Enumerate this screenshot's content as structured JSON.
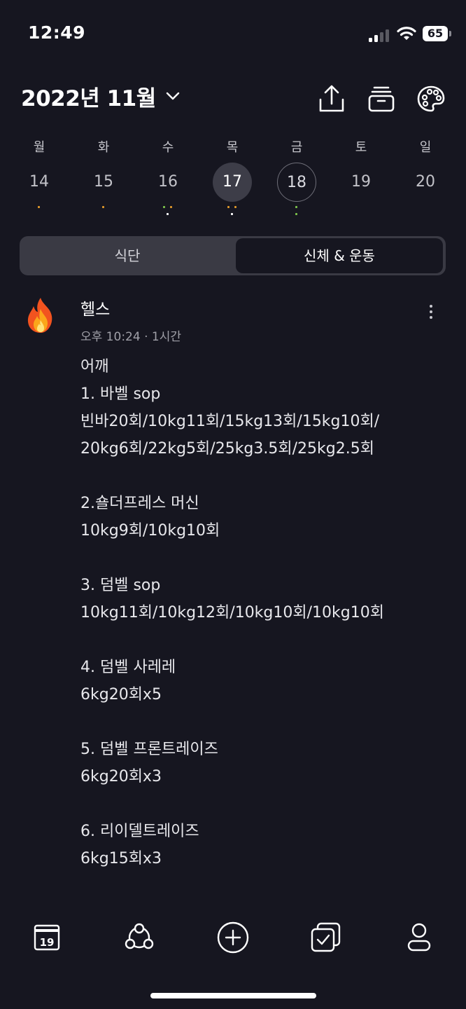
{
  "status": {
    "time": "12:49",
    "battery": "65"
  },
  "header": {
    "title": "2022년 11월"
  },
  "week": [
    {
      "dow": "월",
      "day": "14",
      "state": "normal",
      "dots": [
        {
          "color": "#e0982a"
        }
      ]
    },
    {
      "dow": "화",
      "day": "15",
      "state": "normal",
      "dots": [
        {
          "color": "#e0982a"
        }
      ]
    },
    {
      "dow": "수",
      "day": "16",
      "state": "normal",
      "dots": [
        {
          "color": "#7cc24a"
        },
        {
          "color": "#e0982a"
        },
        {
          "color": "#ffffff"
        }
      ]
    },
    {
      "dow": "목",
      "day": "17",
      "state": "selected",
      "dots": [
        {
          "color": "#e0982a"
        },
        {
          "color": "#e0982a"
        },
        {
          "color": "#ffffff"
        }
      ]
    },
    {
      "dow": "금",
      "day": "18",
      "state": "today",
      "dots": [
        {
          "color": "#7cc24a"
        }
      ]
    },
    {
      "dow": "토",
      "day": "19",
      "state": "normal",
      "dots": []
    },
    {
      "dow": "일",
      "day": "20",
      "state": "normal",
      "dots": []
    }
  ],
  "tabs": {
    "left": "식단",
    "right": "신체 & 운동",
    "active": "right"
  },
  "entry": {
    "title": "헬스",
    "meta": "오후 10:24 · 1시간",
    "lines": [
      "어깨",
      "1. 바벨 sop",
      "빈바20회/10kg11회/15kg13회/15kg10회/",
      "20kg6회/22kg5회/25kg3.5회/25kg2.5회",
      "",
      "2.숄더프레스 머신",
      "10kg9회/10kg10회",
      "",
      "3. 덤벨 sop",
      "10kg11회/10kg12회/10kg10회/10kg10회",
      "",
      "4. 덤벨 사레레",
      "6kg20회x5",
      "",
      "5. 덤벨 프론트레이즈",
      "6kg20회x3",
      "",
      "6. 리이델트레이즈",
      "6kg15회x3"
    ]
  },
  "bottom_nav": {
    "calendar_date": "19"
  }
}
